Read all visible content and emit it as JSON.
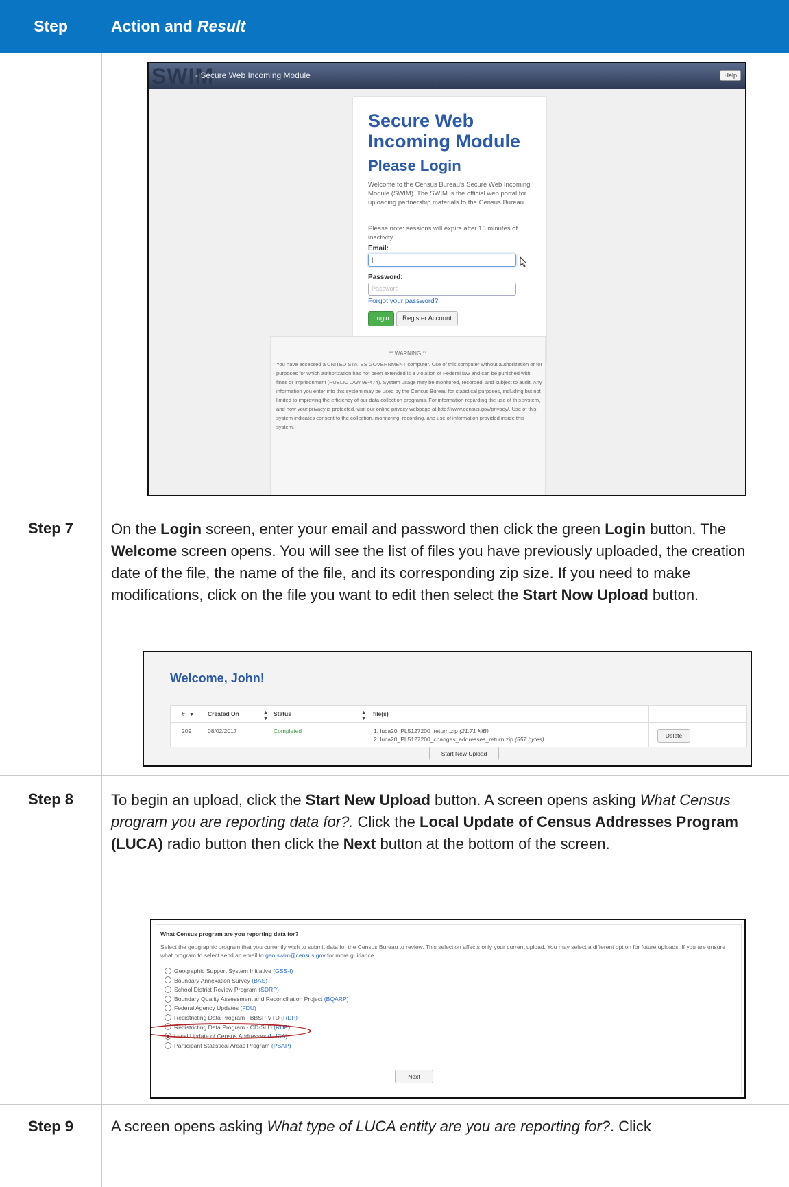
{
  "header": {
    "step": "Step",
    "action_prefix": "Action and",
    "action_italic": "Result"
  },
  "shot1": {
    "logo": "SWIM",
    "subtitle": "- Secure Web Incoming Module",
    "help": "Help",
    "title": "Secure Web Incoming Module",
    "please_login": "Please Login",
    "intro": "Welcome to the Census Bureau's Secure Web Incoming Module (SWIM). The SWIM is the official web portal for uploading partnership materials to the Census Bureau.",
    "note": "Please note: sessions will expire after 15 minutes of inactivity.",
    "email_label": "Email:",
    "email_value": "|",
    "password_label": "Password:",
    "password_placeholder": "Password",
    "forgot": "Forgot your password?",
    "login_btn": "Login",
    "register_btn": "Register Account",
    "warning_heading": "** WARNING **",
    "warning_text": "You have accessed a UNITED STATES GOVERNMENT computer. Use of this computer without authorization or for purposes for which authorization has not been extended is a violation of Federal law and can be punished with fines or imprisonment (PUBLIC LAW 99-474). System usage may be monitored, recorded, and subject to audit. Any information you enter into this system may be used by the Census Bureau for statistical purposes, including but not limited to improving the efficiency of our data collection programs. For information regarding the use of this system, and how your privacy is protected, visit our online privacy webpage at http://www.census.gov/privacy/. Use of this system indicates consent to the collection, monitoring, recording, and use of information provided inside this system."
  },
  "step7": {
    "label": "Step 7",
    "t1": "On the ",
    "b1": "Login",
    "t2": " screen, enter your email and password then click the green ",
    "b2": "Login",
    "t3": " button. The ",
    "b3": "Welcome",
    "t4": " screen opens. You will see the list of files you have previously uploaded, the creation date of the file, the name of the file, and its corresponding zip size. If you need to make modifications, click on the file you want to edit then select the ",
    "b4": "Start Now Upload",
    "t5": " button."
  },
  "shot2": {
    "title": "Welcome, John!",
    "columns": [
      "#",
      "Created On",
      "Status",
      "file(s)"
    ],
    "row": {
      "num": "209",
      "created": "08/02/2017",
      "status": "Completed",
      "file1": "1. luca20_PL5127200_return.zip",
      "file1_size": "(21.71 KiB)",
      "file2": "2. luca20_PL5127200_changes_addresses_return.zip",
      "file2_size": "(557 bytes)"
    },
    "delete": "Delete",
    "start_new": "Start New Upload"
  },
  "step8": {
    "label": "Step 8",
    "t1": "To begin an upload, click the ",
    "b1": "Start New Upload",
    "t2": " button. A screen opens asking ",
    "i1": "What Census program you are reporting data for?.",
    "t3": " Click the ",
    "b2": "Local Update of Census Addresses Program (LUCA)",
    "t4": " radio button then click the ",
    "b3": "Next",
    "t5": " button at the bottom of the screen."
  },
  "shot3": {
    "question": "What Census program are you reporting data for?",
    "para1": "Select the geographic program that you currently wish to submit data for the Census Bureau to review. This selection affects only your current upload. You may select a different option for future uploads. If you are unsure what program to select send an email to ",
    "email": "geo.swim@census.gov",
    "para2": " for more guidance.",
    "options": [
      {
        "label": "Geographic Support System Initiative",
        "abbr": "(GSS-I)"
      },
      {
        "label": "Boundary Annexation Survey",
        "abbr": "(BAS)"
      },
      {
        "label": "School District Review Program",
        "abbr": "(SDRP)"
      },
      {
        "label": "Boundary Quality Assessment and Reconciliation Project",
        "abbr": "(BQARP)"
      },
      {
        "label": "Federal Agency Updates",
        "abbr": "(FDU)"
      },
      {
        "label": "Redistricting Data Program - BBSP-VTD",
        "abbr": "(RDP)"
      },
      {
        "label": "Redistricting Data Program - CD-SLD",
        "abbr": "(RDP)"
      },
      {
        "label": "Local Update of Census Addresses",
        "abbr": "(LUCA)"
      },
      {
        "label": "Participant Statistical Areas Program",
        "abbr": "(PSAP)"
      }
    ],
    "selected_index": 7,
    "next": "Next"
  },
  "step9": {
    "label": "Step 9",
    "t1": "A screen opens asking ",
    "i1": "What type of LUCA entity are you are reporting for?",
    "t2": ". Click"
  }
}
